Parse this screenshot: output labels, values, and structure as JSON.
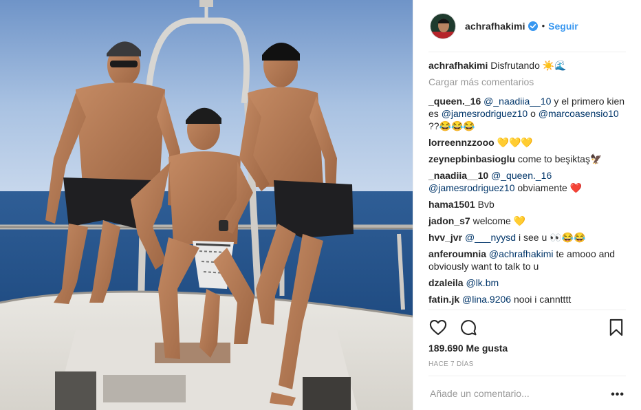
{
  "post": {
    "username": "achrafhakimi",
    "follow_label": "Seguir",
    "separator": "•",
    "caption_user": "achrafhakimi",
    "caption_text": "Disfrutando ☀️🌊",
    "load_more": "Cargar más comentarios",
    "likes": "189.690 Me gusta",
    "timestamp": "HACE 7 DÍAS",
    "comment_placeholder": "Añade un comentario...",
    "more_options": "•••"
  },
  "comments": [
    {
      "user": "_queen._16",
      "parts": [
        {
          "t": " "
        },
        {
          "m": "@_naadiia__10"
        },
        {
          "t": " y el primero kien es "
        },
        {
          "m": "@jamesrodriguez10"
        },
        {
          "t": " o "
        },
        {
          "m": "@marcoasensio10"
        },
        {
          "t": " ??😂😂😂"
        }
      ]
    },
    {
      "user": "lorreennzzooo",
      "parts": [
        {
          "t": " 💛💛💛"
        }
      ]
    },
    {
      "user": "zeynepbinbasioglu",
      "parts": [
        {
          "t": " come to beşiktaş🦅"
        }
      ]
    },
    {
      "user": "_naadiia__10",
      "parts": [
        {
          "t": " "
        },
        {
          "m": "@_queen._16"
        },
        {
          "t": " "
        },
        {
          "m": "@jamesrodriguez10"
        },
        {
          "t": " obviamente ❤️"
        }
      ]
    },
    {
      "user": "hama1501",
      "parts": [
        {
          "t": " Bvb"
        }
      ]
    },
    {
      "user": "jadon_s7",
      "parts": [
        {
          "t": " welcome 💛"
        }
      ]
    },
    {
      "user": "hvv_jvr",
      "parts": [
        {
          "t": " "
        },
        {
          "m": "@___nyysd"
        },
        {
          "t": " i see u 👀😂😂"
        }
      ]
    },
    {
      "user": "anferoumnia",
      "parts": [
        {
          "t": " "
        },
        {
          "m": "@achrafhakimi"
        },
        {
          "t": " te amooo and obviously want to talk to u"
        }
      ]
    },
    {
      "user": "dzaleila",
      "parts": [
        {
          "t": " "
        },
        {
          "m": "@lk.bm"
        }
      ]
    },
    {
      "user": "fatin.jk",
      "parts": [
        {
          "t": " "
        },
        {
          "m": "@lina.9206"
        },
        {
          "t": " nooi i canntttt"
        }
      ]
    }
  ],
  "icons": {
    "verified": "verified-badge-icon",
    "like": "heart-icon",
    "comment": "comment-bubble-icon",
    "save": "bookmark-icon"
  },
  "colors": {
    "link": "#3897f0",
    "mention": "#003569",
    "muted": "#999999",
    "text": "#262626"
  }
}
